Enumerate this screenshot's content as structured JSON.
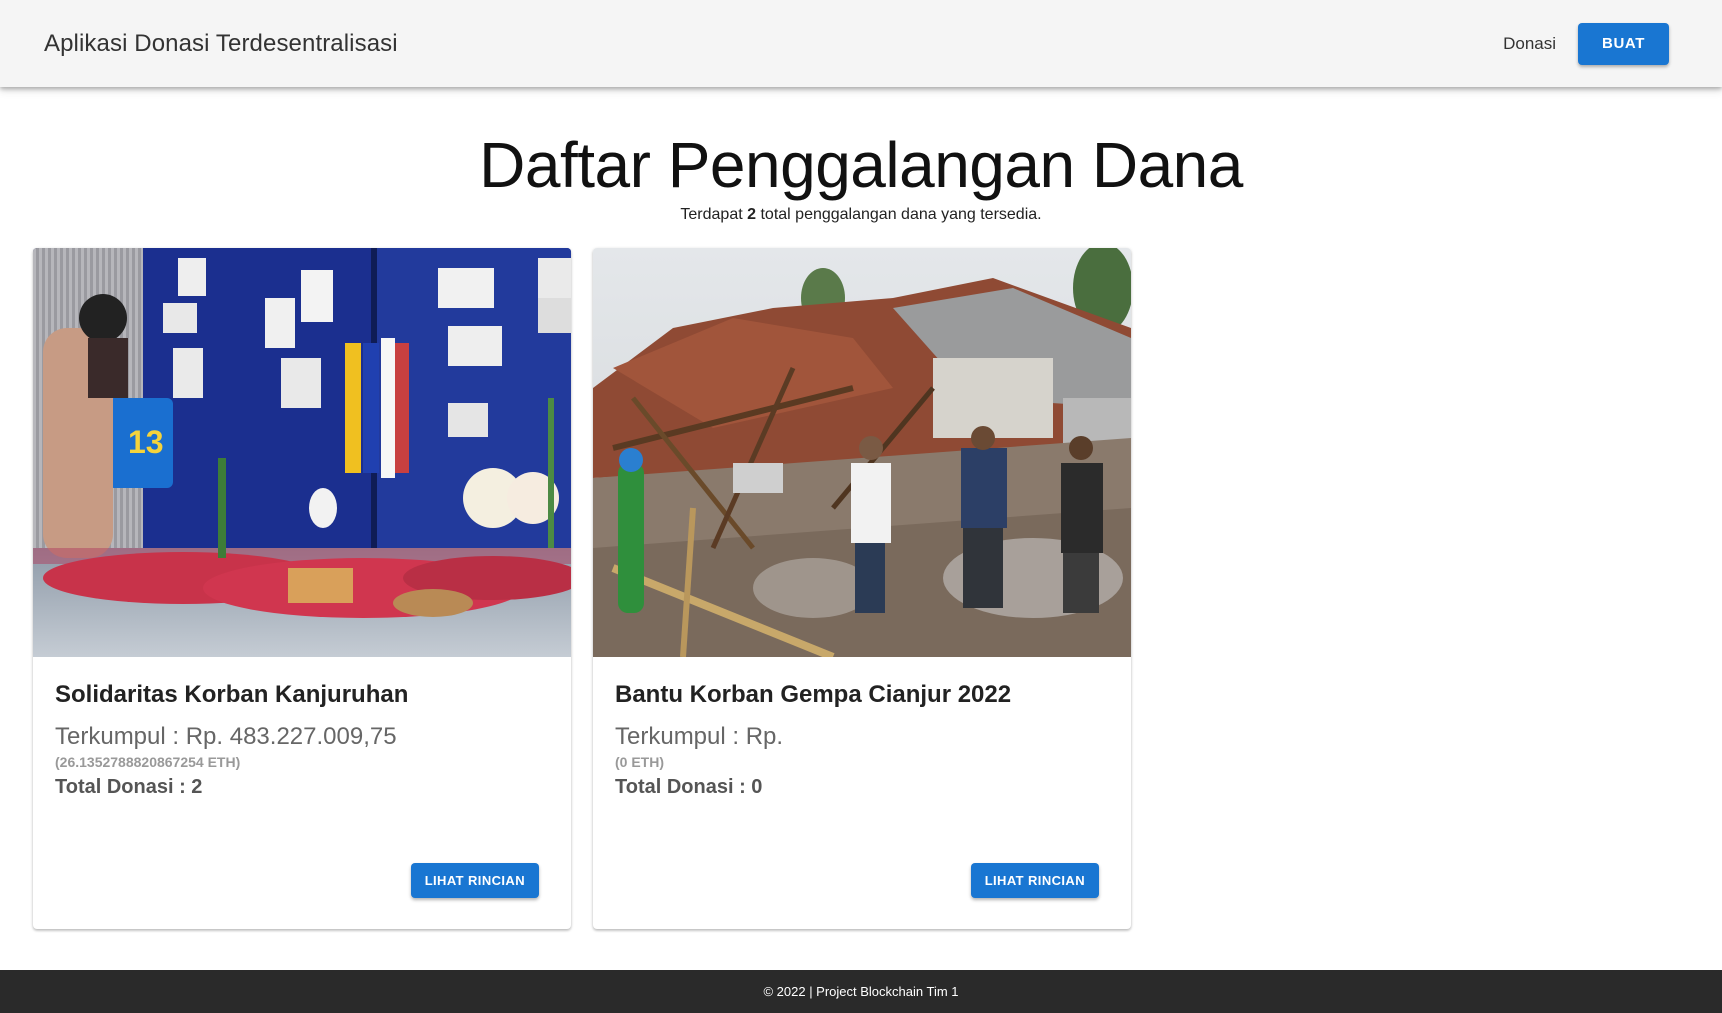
{
  "appbar": {
    "brand": "Aplikasi Donasi Terdesentralisasi",
    "nav_donasi": "Donasi",
    "create_button": "BUAT"
  },
  "header": {
    "title": "Daftar Penggalangan Dana",
    "subtitle_prefix": "Terdapat ",
    "count": "2",
    "subtitle_suffix": " total penggalangan dana yang tersedia."
  },
  "cards": [
    {
      "title": "Solidaritas Korban Kanjuruhan",
      "raised": "Terkumpul : Rp. 483.227.009,75",
      "eth": "(26.1352788820867254 ETH)",
      "total": "Total Donasi : 2",
      "action": "LIHAT RINCIAN"
    },
    {
      "title": "Bantu Korban Gempa Cianjur 2022",
      "raised": "Terkumpul : Rp.",
      "eth": "(0 ETH)",
      "total": "Total Donasi : 0",
      "action": "LIHAT RINCIAN"
    }
  ],
  "footer": {
    "text": "© 2022 | Project Blockchain Tim 1"
  },
  "colors": {
    "primary": "#1976d2",
    "appbar": "#f5f5f5",
    "footer": "#2a2a2a"
  }
}
